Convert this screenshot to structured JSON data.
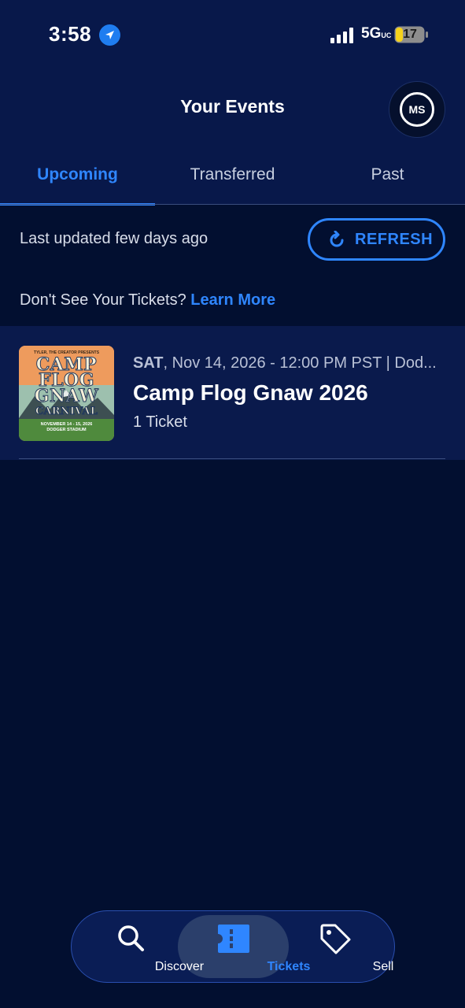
{
  "status_bar": {
    "time": "3:58",
    "network": "5G",
    "network_sub": "UC",
    "battery": "17"
  },
  "header": {
    "title": "Your Events",
    "avatar_initials": "MS"
  },
  "tabs": [
    {
      "label": "Upcoming",
      "active": true
    },
    {
      "label": "Transferred",
      "active": false
    },
    {
      "label": "Past",
      "active": false
    }
  ],
  "refresh_row": {
    "last_updated": "Last updated few days ago",
    "refresh_label": "REFRESH"
  },
  "help": {
    "prompt": "Don't See Your Tickets?",
    "link": "Learn More"
  },
  "events": [
    {
      "day": "SAT",
      "datetime": ", Nov 14, 2026 - 12:00 PM PST | Dod...",
      "title": "Camp Flog Gnaw 2026",
      "tickets": "1 Ticket",
      "image": {
        "presents": "TYLER, THE CREATOR PRESENTS",
        "line1": "CAMP",
        "line2": "FLOG",
        "line3": "GNAW",
        "line4": "CARNIVAL",
        "dates": "NOVEMBER 14 - 15, 2026",
        "venue": "DODGER STADIUM"
      }
    }
  ],
  "bottom_nav": [
    {
      "label": "Discover",
      "icon": "search-icon",
      "active": false
    },
    {
      "label": "Tickets",
      "icon": "ticket-icon",
      "active": true
    },
    {
      "label": "Sell",
      "icon": "tag-icon",
      "active": false
    }
  ],
  "colors": {
    "accent": "#2f86ff",
    "background": "#020f30",
    "header_bg": "#08184a"
  }
}
